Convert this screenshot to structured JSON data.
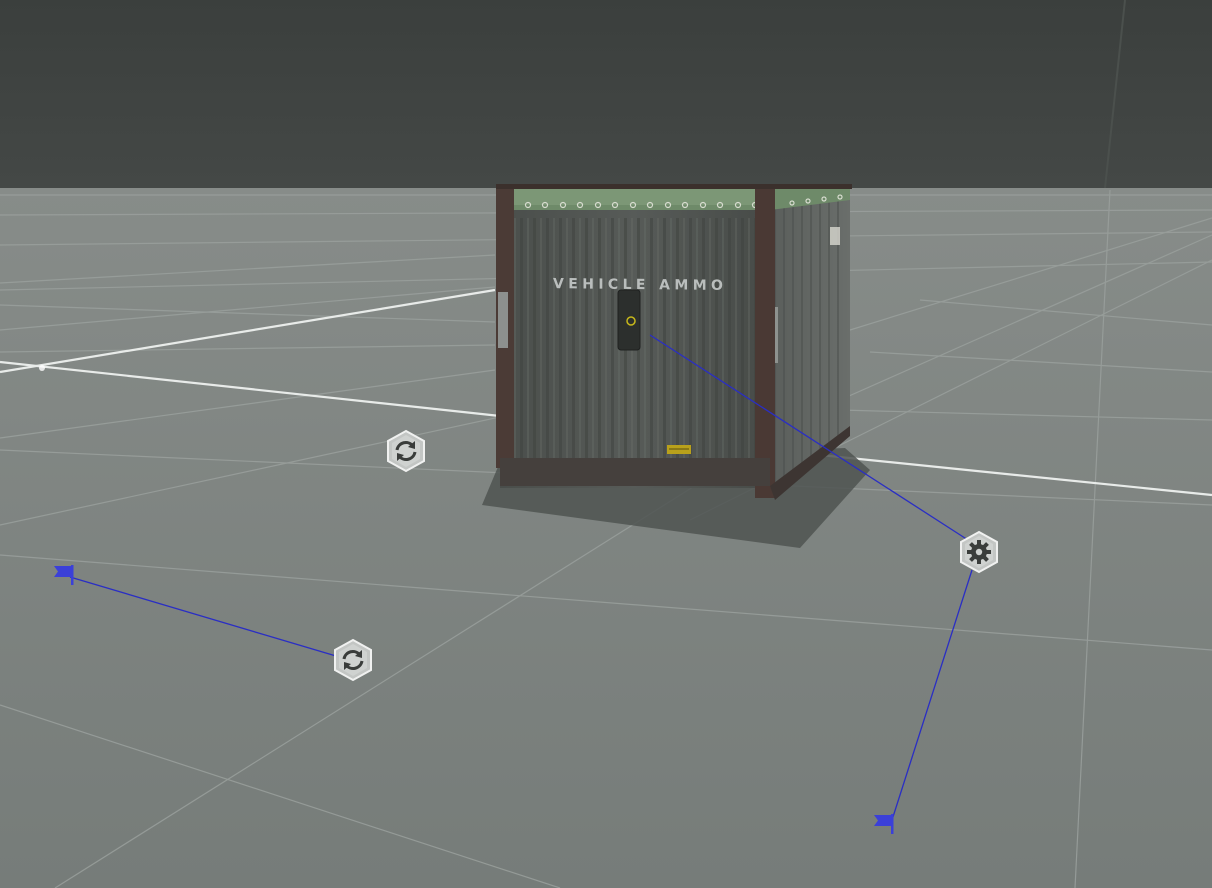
{
  "scene": {
    "sky_color": "#3f4341",
    "ground_color": "#7f8582",
    "grid_line_color": "#9da3a0",
    "axis_line_color": "#e6e9e7",
    "link_line_color": "#2a2ec4"
  },
  "container": {
    "stencil_text": "VEHICLE AMMO",
    "body_color": "#4e524f",
    "tarp_color": "#5f7a5c",
    "frame_color": "#4a3a35"
  },
  "markers": {
    "spawn_a": {
      "icon": "refresh-icon"
    },
    "spawn_b": {
      "icon": "refresh-icon"
    },
    "settings": {
      "icon": "gear-icon"
    }
  },
  "waypoints": {
    "flag_left": {
      "icon": "flag-icon",
      "color": "#3b40d8"
    },
    "flag_right": {
      "icon": "flag-icon",
      "color": "#3b40d8"
    }
  }
}
